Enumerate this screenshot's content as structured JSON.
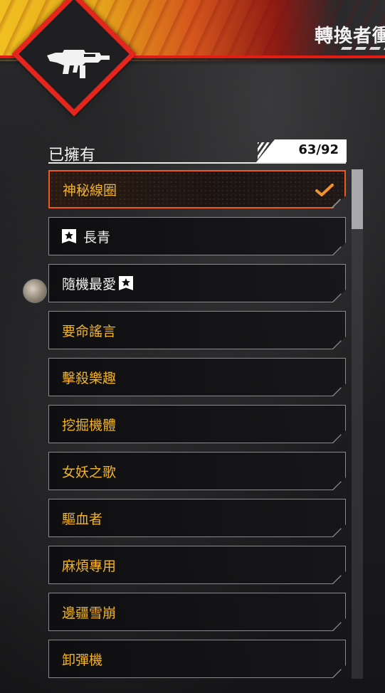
{
  "header": {
    "title": "轉換者衝"
  },
  "weapon_badge": {
    "icon": "smg-weapon-icon",
    "accent_color": "#e4261c"
  },
  "owned_section": {
    "label": "已擁有",
    "count": "63/92"
  },
  "items": [
    {
      "label": "神秘線圈",
      "selected": true,
      "color": "#f1b429",
      "icon": "checkmark-icon"
    },
    {
      "label": "長青",
      "favorite_prefix": true,
      "color": "#f2f2f2"
    },
    {
      "label": "隨機最愛",
      "favorite_suffix": true,
      "color": "#f2f2f2"
    },
    {
      "label": "要命謠言",
      "color": "#f1b429"
    },
    {
      "label": "擊殺樂趣",
      "color": "#f1b429"
    },
    {
      "label": "挖掘機體",
      "color": "#f1b429"
    },
    {
      "label": "女妖之歌",
      "color": "#f1b429"
    },
    {
      "label": "驅血者",
      "color": "#f1b429"
    },
    {
      "label": "麻煩專用",
      "color": "#f1b429"
    },
    {
      "label": "邊疆雪崩",
      "color": "#f1b429"
    },
    {
      "label": "卸彈機",
      "color": "#f1b429"
    }
  ],
  "scroll": {
    "position": 0.0
  }
}
